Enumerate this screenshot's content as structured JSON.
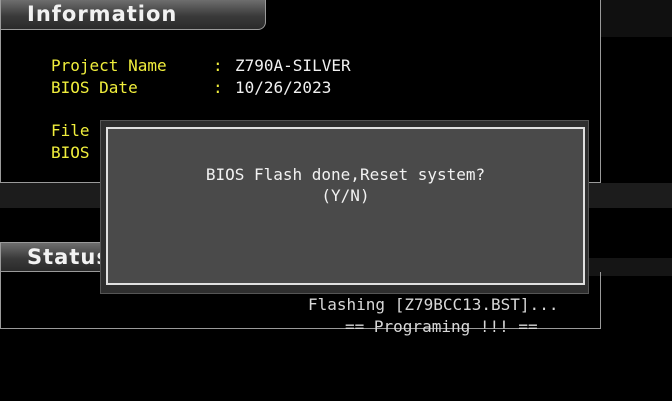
{
  "information": {
    "header": "Information",
    "project_name_label": "Project Name",
    "project_name_value": "Z790A-SILVER",
    "bios_date_label": "BIOS Date",
    "bios_date_value": "10/26/2023",
    "file_label": "File",
    "bios_label_partial": "BIOS",
    "separator": ":"
  },
  "status": {
    "header": "Status",
    "flashing_text": "Flashing [Z79BCC13.BST]...",
    "programing_text": "== Programing !!! =="
  },
  "dialog": {
    "message": "BIOS Flash done,Reset system?",
    "options": "(Y/N)"
  },
  "colors": {
    "label_yellow": "#f0ee3c",
    "value_white": "#f0f0f0",
    "background": "#000000",
    "dialog_fill": "#4a4a4a"
  }
}
